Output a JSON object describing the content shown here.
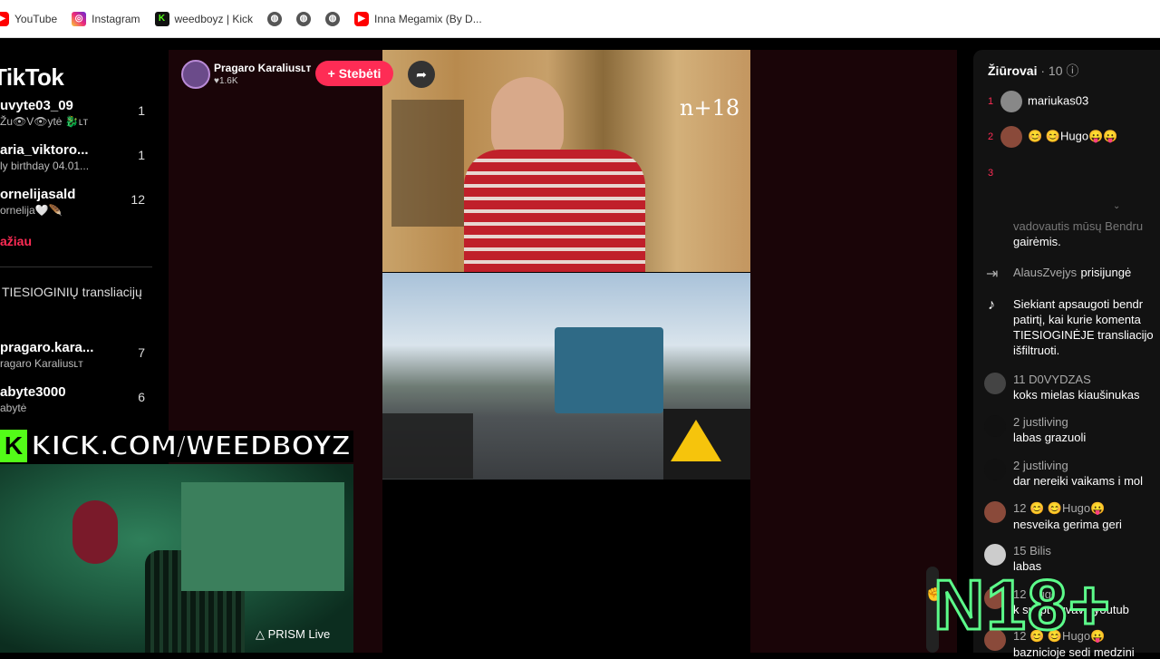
{
  "bookmarks": [
    {
      "label": "YouTube",
      "icon": "youtube-icon"
    },
    {
      "label": "Instagram",
      "icon": "instagram-icon"
    },
    {
      "label": "weedboyz | Kick",
      "icon": "kick-icon"
    },
    {
      "label": "",
      "icon": "globe-icon"
    },
    {
      "label": "",
      "icon": "globe-icon"
    },
    {
      "label": "",
      "icon": "globe-icon"
    },
    {
      "label": "Inna Megamix (By D...",
      "icon": "youtube-icon"
    }
  ],
  "sidebar": {
    "logo": "TikTok",
    "items": [
      {
        "name": "uvyte03_09",
        "sub": "Žu👁V👁ytė 🐉ʟᴛ",
        "count": "1"
      },
      {
        "name": "aria_viktoro...",
        "sub": "ly birthday 04.01...",
        "count": "1"
      },
      {
        "name": "ornelijasald",
        "sub": "ornelija🤍🪶",
        "count": "12"
      },
      {
        "name": "pragaro.kara...",
        "sub": "ragaro Karaliusʟᴛ",
        "count": "7"
      },
      {
        "name": "abyte3000",
        "sub": "abytė",
        "count": "6"
      }
    ],
    "more_label": "ažiau",
    "section_label": "TIESIOGINIŲ transliacijų"
  },
  "player": {
    "host_name": "Pragaro Karaliusʟᴛ",
    "likes": "♥1.6K",
    "follow_label": "+ Stebėti",
    "watermark": "n+18"
  },
  "overlay": {
    "kick_text": "KICK.COM/WEEDBOYZ",
    "prism_label": "PRISM Live",
    "n18_text": "N18+"
  },
  "chat": {
    "title": "Žiūrovai",
    "viewer_count": "· 10",
    "top_viewers": [
      {
        "rank": "1",
        "name": "mariukas03"
      },
      {
        "rank": "2",
        "name": "😊 😊Hugo😛😛"
      },
      {
        "rank": "3",
        "name": ""
      }
    ],
    "messages": [
      {
        "user": "vadovautis mūsų Bendru",
        "text": "gairėmis."
      },
      {
        "user": "AlausZvejys",
        "text": "prisijungė"
      },
      {
        "user": "Siekiant apsaugoti bendr",
        "text": "patirtį, kai kurie komenta"
      },
      {
        "user": "11  D0VYDZAS",
        "text": "koks mielas kiaušinukas"
      },
      {
        "user": "2  justliving",
        "text": "labas grazuoli"
      },
      {
        "user": "2  justliving",
        "text": "dar nereiki vaikams i mol"
      },
      {
        "user": "12  😊 😊Hugo😛",
        "text": "nesveika gerima geri"
      },
      {
        "user": "15  Bilis",
        "text": "labas"
      },
      {
        "user": "12  Hugo",
        "text": "k sulipt suvavo youtub"
      },
      {
        "user": "12  😊 😊Hugo😛",
        "text": "baznicioje sedi medzini"
      }
    ],
    "system_line_3": "TIESIOGINĖJE transliacijo",
    "system_line_4": "išfiltruoti."
  },
  "colors": {
    "accent": "#fe2c55",
    "kick_green": "#53fc18",
    "n18_green": "#5cfb8a"
  }
}
